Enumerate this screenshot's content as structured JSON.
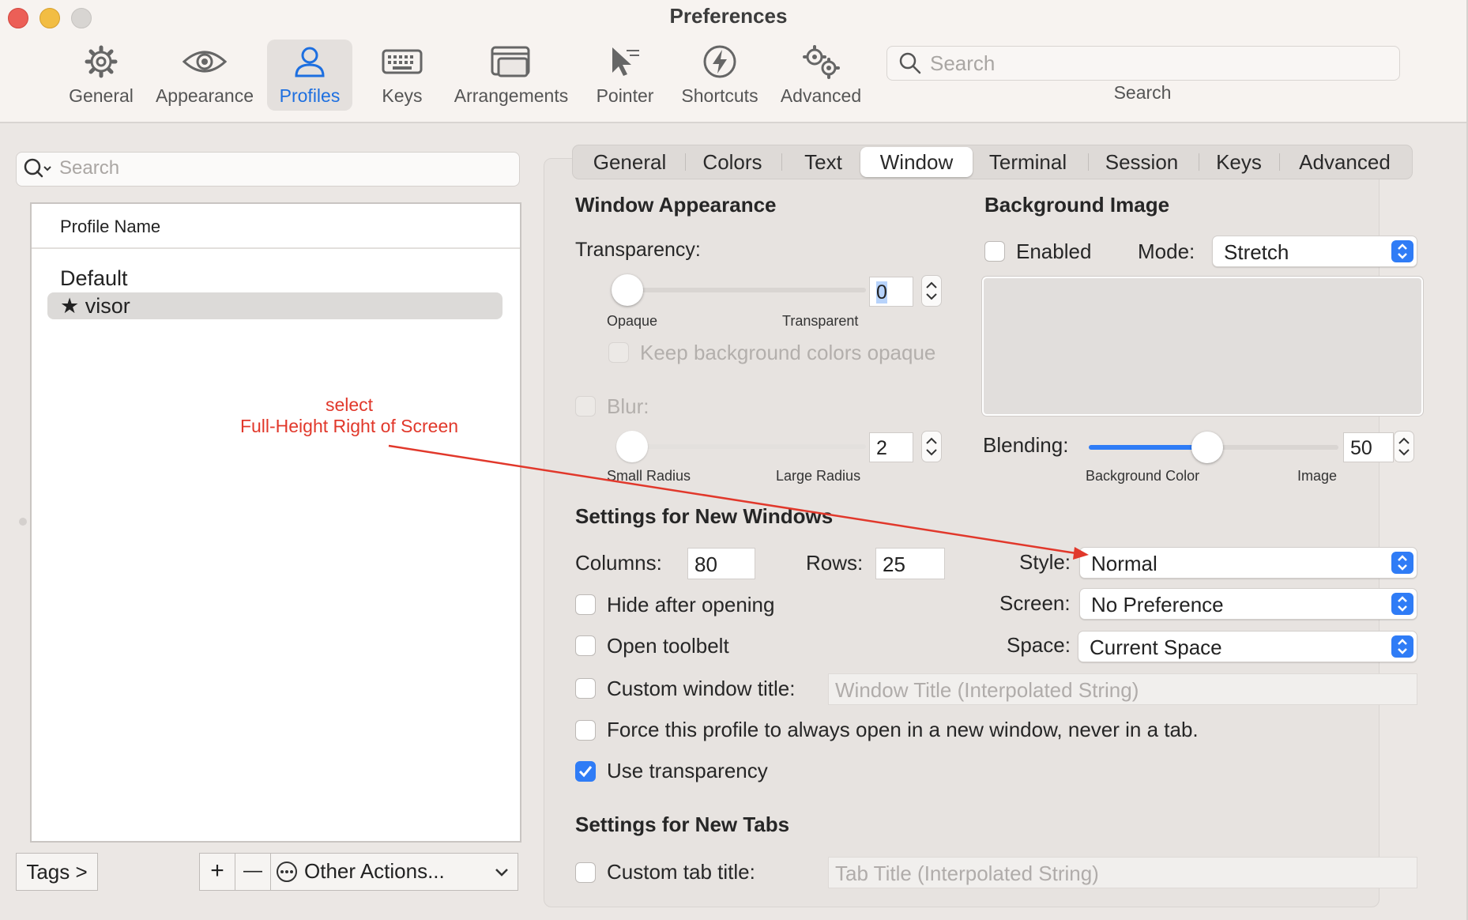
{
  "window": {
    "title": "Preferences"
  },
  "toolbar": {
    "items": [
      {
        "label": "General",
        "icon": "gear-icon"
      },
      {
        "label": "Appearance",
        "icon": "eye-icon"
      },
      {
        "label": "Profiles",
        "icon": "person-icon",
        "active": true
      },
      {
        "label": "Keys",
        "icon": "keyboard-icon"
      },
      {
        "label": "Arrangements",
        "icon": "windows-icon"
      },
      {
        "label": "Pointer",
        "icon": "pointer-icon"
      },
      {
        "label": "Shortcuts",
        "icon": "lightning-icon"
      },
      {
        "label": "Advanced",
        "icon": "gears-icon"
      }
    ],
    "search_placeholder": "Search",
    "search_label": "Search"
  },
  "profiles": {
    "search_placeholder": "Search",
    "column_header": "Profile Name",
    "items": [
      {
        "name": "Default"
      },
      {
        "name": "★ visor",
        "selected": true
      }
    ],
    "tags_button": "Tags >",
    "add": "+",
    "remove": "—",
    "other_actions": "Other Actions..."
  },
  "tabs": [
    "General",
    "Colors",
    "Text",
    "Window",
    "Terminal",
    "Session",
    "Keys",
    "Advanced"
  ],
  "active_tab": "Window",
  "window_appearance": {
    "heading": "Window Appearance",
    "transparency_label": "Transparency:",
    "transparency_value": "0",
    "transparency_min_label": "Opaque",
    "transparency_max_label": "Transparent",
    "keep_bg_opaque": "Keep background colors opaque",
    "blur_label": "Blur:",
    "blur_value": "2",
    "blur_min_label": "Small Radius",
    "blur_max_label": "Large Radius"
  },
  "background_image": {
    "heading": "Background Image",
    "enabled_label": "Enabled",
    "mode_label": "Mode:",
    "mode_value": "Stretch",
    "blending_label": "Blending:",
    "blending_value": "50",
    "blending_fraction": 0.5,
    "blending_min_label": "Background Color",
    "blending_max_label": "Image"
  },
  "new_windows": {
    "heading": "Settings for New Windows",
    "columns_label": "Columns:",
    "columns_value": "80",
    "rows_label": "Rows:",
    "rows_value": "25",
    "style_label": "Style:",
    "style_value": "Normal",
    "screen_label": "Screen:",
    "screen_value": "No Preference",
    "space_label": "Space:",
    "space_value": "Current Space",
    "hide_after_opening": "Hide after opening",
    "open_toolbelt": "Open toolbelt",
    "custom_window_title": "Custom window title:",
    "window_title_placeholder": "Window Title (Interpolated String)",
    "force_new_window": "Force this profile to always open in a new window, never in a tab.",
    "use_transparency": "Use transparency",
    "use_transparency_checked": true
  },
  "new_tabs": {
    "heading": "Settings for New Tabs",
    "custom_tab_title": "Custom tab title:",
    "tab_title_placeholder": "Tab Title (Interpolated String)"
  },
  "annotation": {
    "line1": "select",
    "line2": "Full-Height Right of Screen",
    "color": "#e1382b"
  },
  "colors": {
    "accent": "#2f7cf6",
    "active_toolbar": "#1d6fe0"
  }
}
